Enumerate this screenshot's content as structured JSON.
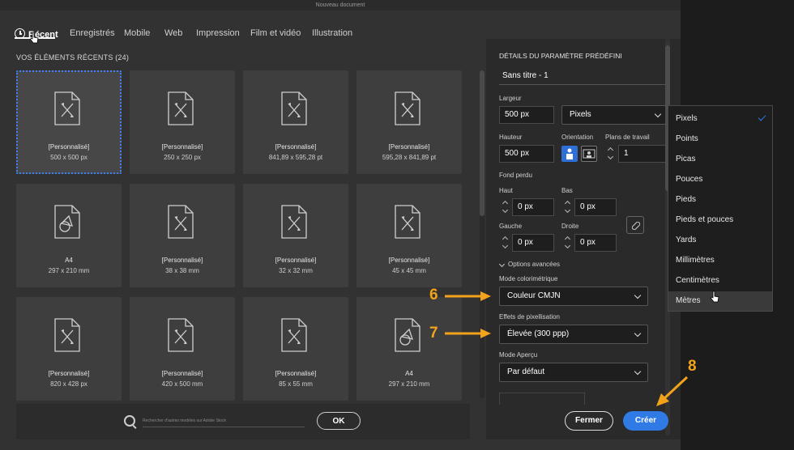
{
  "window": {
    "title": "Nouveau document"
  },
  "tabs": [
    "Récent",
    "Enregistrés",
    "Mobile",
    "Web",
    "Impression",
    "Film et vidéo",
    "Illustration"
  ],
  "recent": {
    "title": "VOS ÉLÉMENTS RÉCENTS",
    "count": "(24)",
    "items": [
      {
        "name": "[Personnalisé]",
        "size": "500 x 500 px",
        "icon": "custom-doc-icon",
        "selected": true
      },
      {
        "name": "[Personnalisé]",
        "size": "250 x 250 px",
        "icon": "custom-doc-icon"
      },
      {
        "name": "[Personnalisé]",
        "size": "841,89 x 595,28 pt",
        "icon": "custom-doc-icon"
      },
      {
        "name": "[Personnalisé]",
        "size": "595,28 x 841,89 pt",
        "icon": "custom-doc-icon"
      },
      {
        "name": "A4",
        "size": "297 x 210 mm",
        "icon": "shapes-doc-icon"
      },
      {
        "name": "[Personnalisé]",
        "size": "38 x 38 mm",
        "icon": "custom-doc-icon"
      },
      {
        "name": "[Personnalisé]",
        "size": "32 x 32 mm",
        "icon": "custom-doc-icon"
      },
      {
        "name": "[Personnalisé]",
        "size": "45 x 45 mm",
        "icon": "custom-doc-icon"
      },
      {
        "name": "[Personnalisé]",
        "size": "820 x 428 px",
        "icon": "custom-doc-icon"
      },
      {
        "name": "[Personnalisé]",
        "size": "420 x 500 mm",
        "icon": "custom-doc-icon"
      },
      {
        "name": "[Personnalisé]",
        "size": "85 x 55 mm",
        "icon": "custom-doc-icon"
      },
      {
        "name": "A4",
        "size": "297 x 210 mm",
        "icon": "shapes-doc-icon"
      }
    ]
  },
  "search": {
    "placeholder": "Rechercher d'autres modèles sur Adobe Stock",
    "ok_label": "OK"
  },
  "panel": {
    "title": "DÉTAILS DU PARAMÈTRE PRÉDÉFINI",
    "doc_name": "Sans titre - 1",
    "width_label": "Largeur",
    "width_value": "500 px",
    "unit_value": "Pixels",
    "height_label": "Hauteur",
    "height_value": "500 px",
    "orientation_label": "Orientation",
    "artboards_label": "Plans de travail",
    "artboards_value": "1",
    "bleed_label": "Fond perdu",
    "top_label": "Haut",
    "top_value": "0 px",
    "bottom_label": "Bas",
    "bottom_value": "0 px",
    "left_label": "Gauche",
    "left_value": "0 px",
    "right_label": "Droite",
    "right_value": "0 px",
    "advanced_label": "Options avancées",
    "color_mode_label": "Mode colorimétrique",
    "color_mode_value": "Couleur CMJN",
    "raster_label": "Effets de pixellisation",
    "raster_value": "Élevée (300 ppp)",
    "preview_label": "Mode Aperçu",
    "preview_value": "Par défaut",
    "close_label": "Fermer",
    "create_label": "Créer"
  },
  "unit_dropdown": {
    "options": [
      "Pixels",
      "Points",
      "Picas",
      "Pouces",
      "Pieds",
      "Pieds et pouces",
      "Yards",
      "Millimètres",
      "Centimètres",
      "Mètres"
    ],
    "checked": "Pixels",
    "hovered": "Mètres"
  },
  "annotations": [
    "6",
    "7",
    "8"
  ],
  "colors": {
    "accent": "#2f7ae5",
    "annotation": "#f2a21b",
    "selection": "#3d7ef0"
  }
}
